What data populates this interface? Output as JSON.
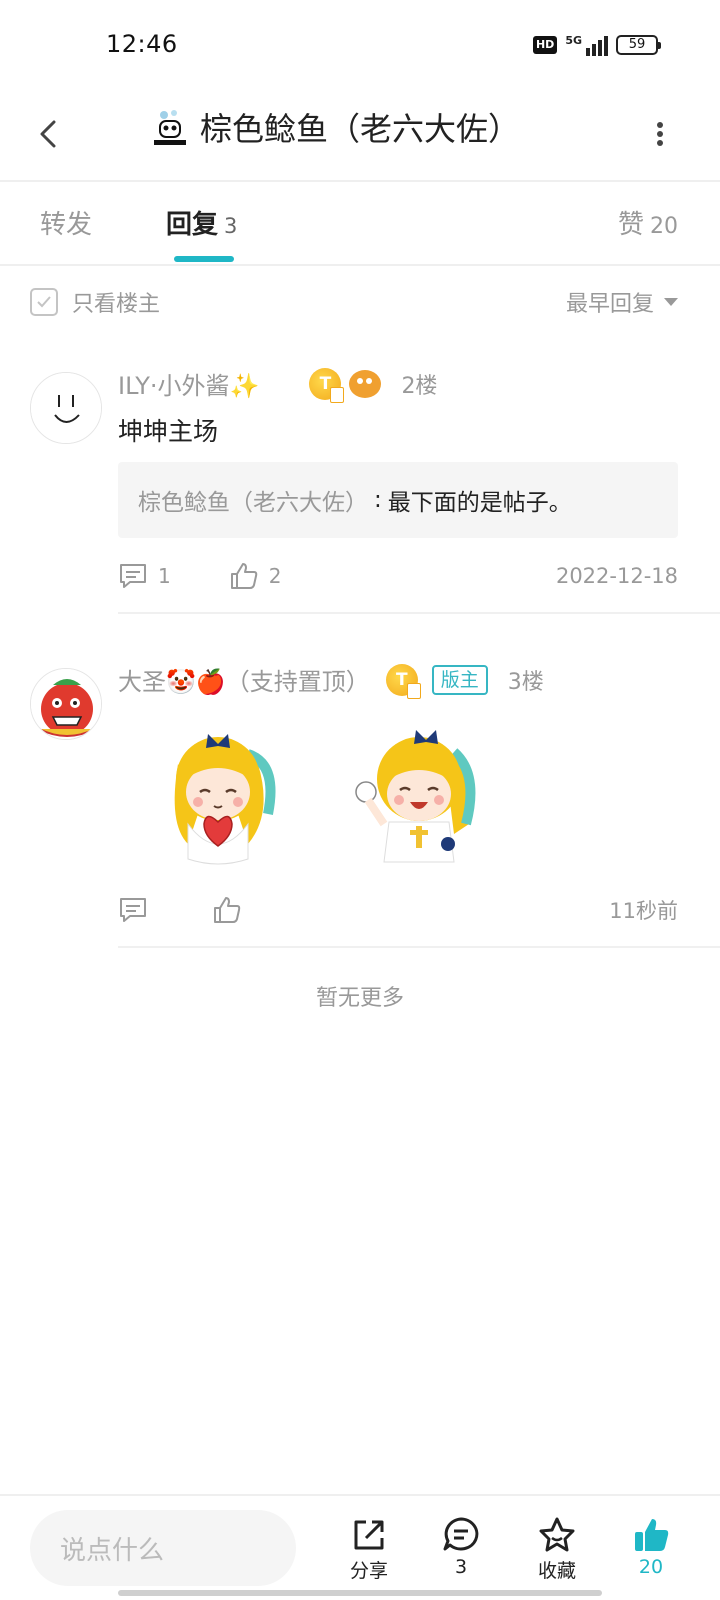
{
  "status_bar": {
    "time": "12:46",
    "network": "5G",
    "hd": "HD",
    "battery": "59"
  },
  "header": {
    "title": "棕色鲶鱼（老六大佐）",
    "avatar_icon": "user-avatar-panda",
    "back_icon": "chevron-left-icon",
    "more_icon": "vertical-dots-icon"
  },
  "tabs": {
    "forward": "转发",
    "reply": "回复",
    "reply_count": "3",
    "like": "赞",
    "like_count": "20",
    "active_color": "#1fb7c6"
  },
  "filter": {
    "only_host": "只看楼主",
    "sort": "最早回复"
  },
  "replies": [
    {
      "user": "ILY·小外酱✨",
      "floor": "2楼",
      "content": "坤坤主场",
      "quote_author": "棕色鲶鱼（老六大佐）",
      "quote_sep": ":",
      "quote_text": "最下面的是帖子。",
      "comment_count": "1",
      "like_count": "2",
      "time": "2022-12-18"
    },
    {
      "user": "大圣🤡🍎（支持置顶）",
      "badge": "版主",
      "floor": "3楼",
      "time": "11秒前"
    }
  ],
  "no_more": "暂无更多",
  "bottom_bar": {
    "input_placeholder": "说点什么",
    "share_label": "分享",
    "comment_count": "3",
    "fav_label": "收藏",
    "like_count": "20"
  }
}
